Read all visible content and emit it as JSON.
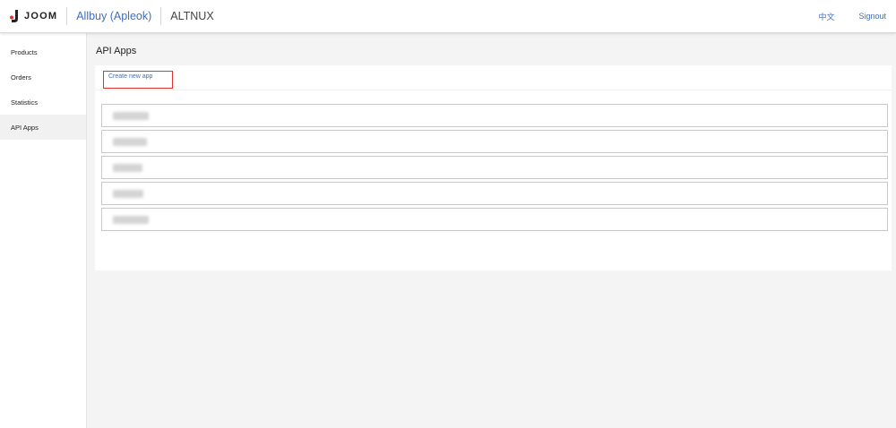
{
  "header": {
    "logo_text": "JOOM",
    "logo_color": "#e0322f",
    "shop_name": "Allbuy (Apleok)",
    "store_name": "ALTNUX",
    "language_link": "中文",
    "signout_label": "Signout",
    "link_color": "#3f6fc0"
  },
  "sidebar": {
    "items": [
      {
        "label": "Products"
      },
      {
        "label": "Orders"
      },
      {
        "label": "Statistics"
      },
      {
        "label": "API Apps",
        "active": true
      }
    ]
  },
  "main": {
    "title": "API Apps",
    "create_link": "Create new app",
    "highlight_color": "#e0322f",
    "apps": [
      {
        "name": ""
      },
      {
        "name": ""
      },
      {
        "name": ""
      },
      {
        "name": ""
      },
      {
        "name": ""
      }
    ]
  }
}
